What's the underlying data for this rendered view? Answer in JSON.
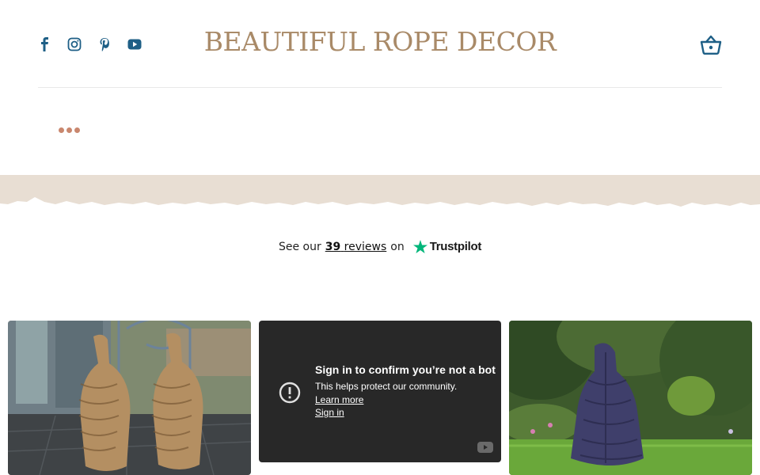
{
  "header": {
    "brand": "BEAUTIFUL ROPE DECOR",
    "social": [
      "facebook-icon",
      "instagram-icon",
      "pinterest-icon",
      "youtube-icon"
    ],
    "cart_icon": "basket-icon"
  },
  "menu": {
    "icon": "more-dots-icon"
  },
  "trustpilot": {
    "prefix": "See our",
    "count": "39",
    "reviews_word": "reviews",
    "suffix": "on",
    "brand": "Trustpilot",
    "star_color": "#00b67a"
  },
  "video_embed": {
    "title": "Sign in to confirm you’re not a bot",
    "subtitle": "This helps protect our community.",
    "learn_more": "Learn more",
    "sign_in": "Sign in"
  },
  "colors": {
    "accent": "#a98a68",
    "icons": "#1e5f86",
    "dots": "#c9876e",
    "band": "#e8ded3"
  }
}
